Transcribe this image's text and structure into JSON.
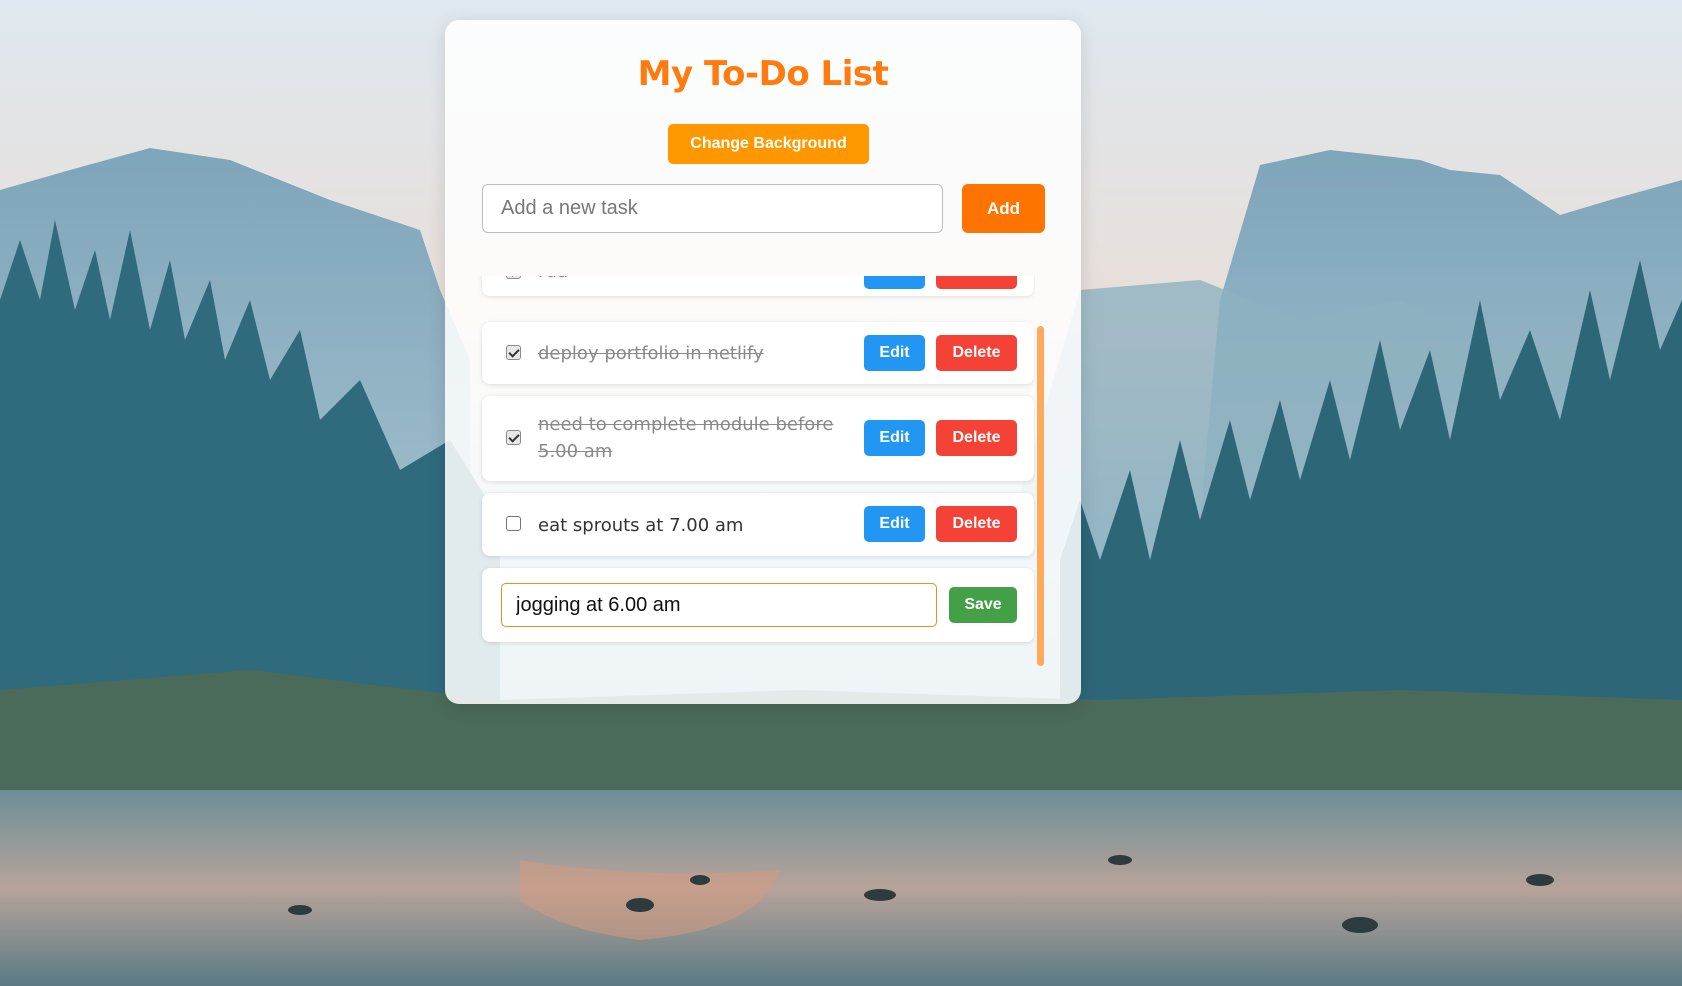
{
  "app": {
    "title": "My To-Do List",
    "change_background_label": "Change Background",
    "new_task_placeholder": "Add a new task",
    "add_label": "Add"
  },
  "colors": {
    "accent": "#ff7b0f",
    "add_button": "#ff7300",
    "change_background_button": "#ff9800",
    "edit_button": "#2196f3",
    "delete_button": "#f44336",
    "save_button": "#43a047",
    "scrollbar_thumb": "#ffa95c"
  },
  "tasks": [
    {
      "text": "rud",
      "completed": true,
      "edit_label": "Edit",
      "delete_label": "Delete"
    },
    {
      "text": "deploy portfolio in netlify",
      "completed": true,
      "edit_label": "Edit",
      "delete_label": "Delete"
    },
    {
      "text": "need to complete module before 5.00 am",
      "completed": true,
      "edit_label": "Edit",
      "delete_label": "Delete"
    },
    {
      "text": "eat sprouts at 7.00 am",
      "completed": false,
      "edit_label": "Edit",
      "delete_label": "Delete"
    }
  ],
  "editing_task": {
    "value": "jogging at 6.00 am",
    "save_label": "Save"
  }
}
